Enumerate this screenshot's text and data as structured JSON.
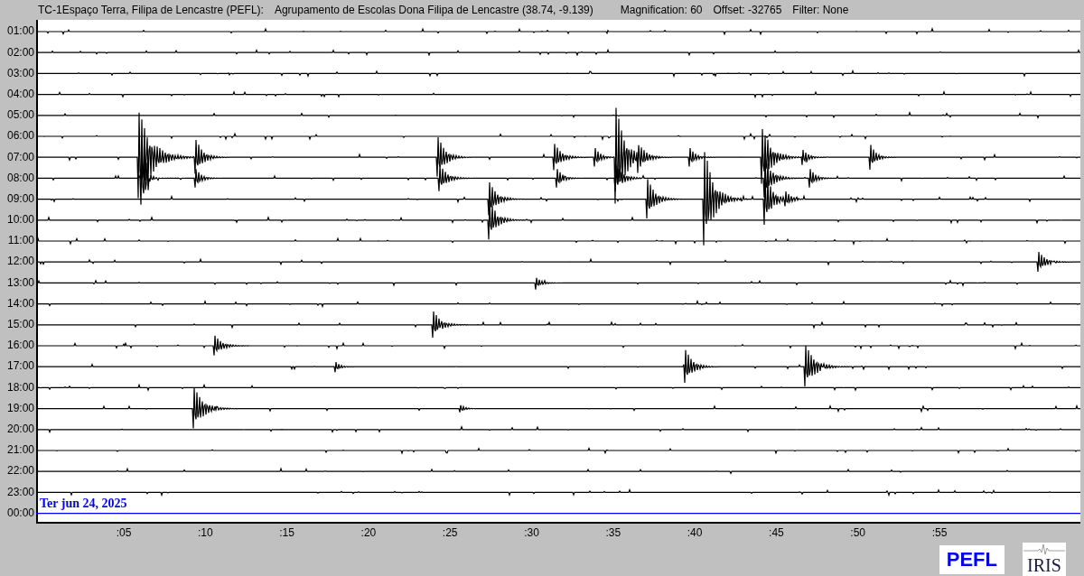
{
  "header": {
    "station": "TC-1Espaço Terra, Filipa de Lencastre (PEFL):",
    "location": "Agrupamento de Escolas Dona Filipa de Lencastre (38.74, -9.139)",
    "magnification": "Magnification: 60",
    "offset": "Offset: -32765",
    "filter": "Filter: None"
  },
  "hour_labels": [
    "01:00",
    "02:00",
    "03:00",
    "04:00",
    "05:00",
    "06:00",
    "07:00",
    "08:00",
    "09:00",
    "10:00",
    "11:00",
    "12:00",
    "13:00",
    "14:00",
    "15:00",
    "16:00",
    "17:00",
    "18:00",
    "19:00",
    "20:00",
    "21:00",
    "22:00",
    "23:00",
    "00:00"
  ],
  "date_label": "Ter jun 24, 2025",
  "x_ticks": [
    ":05",
    ":10",
    ":15",
    ":20",
    ":25",
    ":30",
    ":35",
    ":40",
    ":45",
    ":50",
    ":55"
  ],
  "logos": {
    "station": "PEFL",
    "network": "IRIS"
  }
}
